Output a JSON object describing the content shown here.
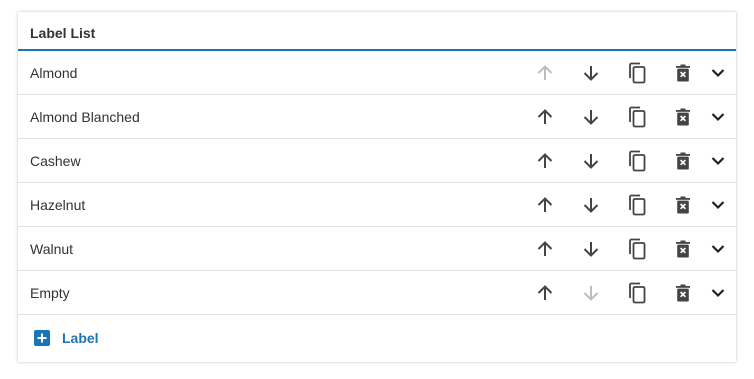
{
  "panel": {
    "title": "Label List"
  },
  "items": [
    {
      "label": "Almond",
      "up_enabled": false,
      "down_enabled": true
    },
    {
      "label": "Almond Blanched",
      "up_enabled": true,
      "down_enabled": true
    },
    {
      "label": "Cashew",
      "up_enabled": true,
      "down_enabled": true
    },
    {
      "label": "Hazelnut",
      "up_enabled": true,
      "down_enabled": true
    },
    {
      "label": "Walnut",
      "up_enabled": true,
      "down_enabled": true
    },
    {
      "label": "Empty",
      "up_enabled": true,
      "down_enabled": false
    }
  ],
  "icons": {
    "move_up": "arrow-up-icon",
    "move_down": "arrow-down-icon",
    "duplicate": "copy-icon",
    "delete": "trash-icon",
    "expand": "chevron-down-icon",
    "add": "plus-icon"
  },
  "add_button": {
    "label": "Label"
  },
  "colors": {
    "accent": "#1a75b4",
    "icon": "#444444",
    "border": "#e3e3e3"
  }
}
